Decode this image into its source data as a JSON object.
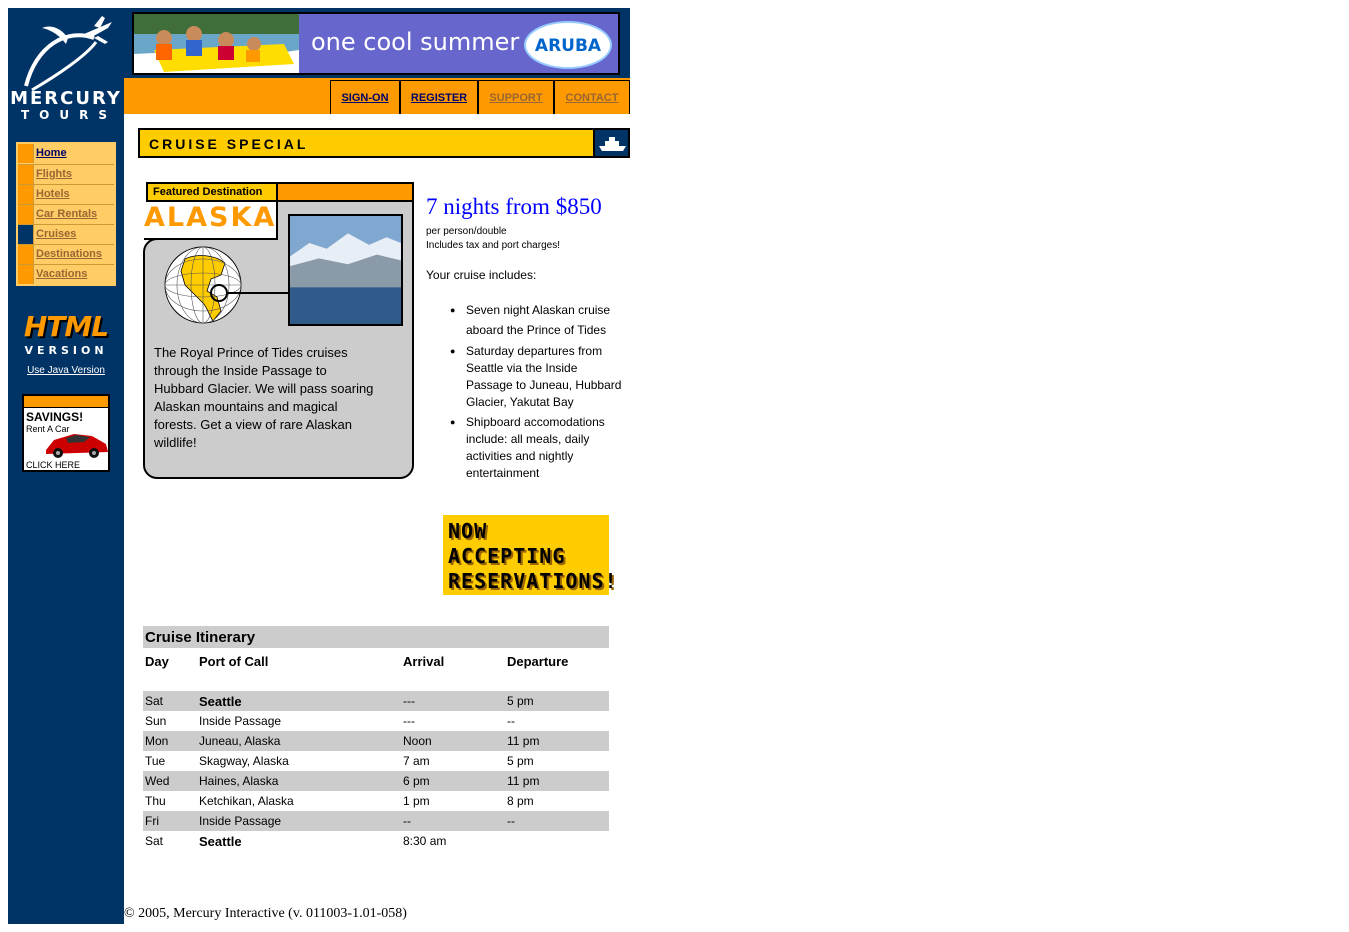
{
  "logo": {
    "line1": "MERCURY",
    "line2": "TOURS"
  },
  "sidebar": {
    "items": [
      {
        "label": "Home",
        "active": false
      },
      {
        "label": "Flights",
        "active": false
      },
      {
        "label": "Hotels",
        "active": false
      },
      {
        "label": "Car Rentals",
        "active": false
      },
      {
        "label": "Cruises",
        "active": true
      },
      {
        "label": "Destinations",
        "active": false
      },
      {
        "label": "Vacations",
        "active": false
      }
    ],
    "html_version": {
      "big": "HTML",
      "small": "VERSION",
      "java_link": "Use Java Version"
    },
    "ad": {
      "title": "SAVINGS!",
      "subtitle": "Rent A Car",
      "cta": "CLICK HERE"
    }
  },
  "banner": {
    "tagline": "one cool summer",
    "brand": "ARUBA"
  },
  "toplinks": [
    "SIGN-ON",
    "REGISTER",
    "SUPPORT",
    "CONTACT"
  ],
  "section": {
    "title": "CRUISE SPECIAL",
    "icon": "ship-icon"
  },
  "featured": {
    "label": "Featured Destination",
    "destination": "ALASKA",
    "description": "The Royal Prince of Tides cruises through the Inside Passage to Hubbard Glacier. We will pass soaring Alaskan mountains and magical forests. Get a view of rare Alaskan wildlife!"
  },
  "offer": {
    "price": "7 nights from $850",
    "sub1": "per person/double",
    "sub2": "Includes tax and port charges!",
    "includes_label": "Your cruise includes:",
    "includes": [
      "Seven night Alaskan cruise aboard the Prince of Tides",
      "Saturday departures from Seattle via the Inside Passage to Juneau, Hubbard Glacier, Yakutat Bay",
      "Shipboard accomodations include: all meals, daily activities and nightly entertainment"
    ],
    "banner_lines": [
      "NOW",
      "ACCEPTING",
      "RESERVATIONS!"
    ]
  },
  "itinerary": {
    "title": "Cruise Itinerary",
    "columns": [
      "Day",
      "Port of Call",
      "Arrival",
      "Departure"
    ],
    "rows": [
      {
        "day": "Sat",
        "port": "Seattle",
        "arrival": "---",
        "departure": "5 pm"
      },
      {
        "day": "Sun",
        "port": "Inside Passage",
        "arrival": "---",
        "departure": "--"
      },
      {
        "day": "Mon",
        "port": "Juneau, Alaska",
        "arrival": "Noon",
        "departure": "11 pm"
      },
      {
        "day": "Tue",
        "port": "Skagway, Alaska",
        "arrival": "7 am",
        "departure": "5 pm"
      },
      {
        "day": "Wed",
        "port": "Haines, Alaska",
        "arrival": "6 pm",
        "departure": "11 pm"
      },
      {
        "day": "Thu",
        "port": "Ketchikan, Alaska",
        "arrival": "1 pm",
        "departure": "8 pm"
      },
      {
        "day": "Fri",
        "port": "Inside Passage",
        "arrival": "--",
        "departure": "--"
      },
      {
        "day": "Sat",
        "port": "Seattle",
        "arrival": "8:30 am",
        "departure": ""
      }
    ]
  },
  "footer": "© 2005, Mercury Interactive (v. 011003-1.01-058)",
  "colors": {
    "navy": "#003366",
    "orange": "#ff9900",
    "yellow": "#ffcc00",
    "gray": "#cccccc"
  }
}
